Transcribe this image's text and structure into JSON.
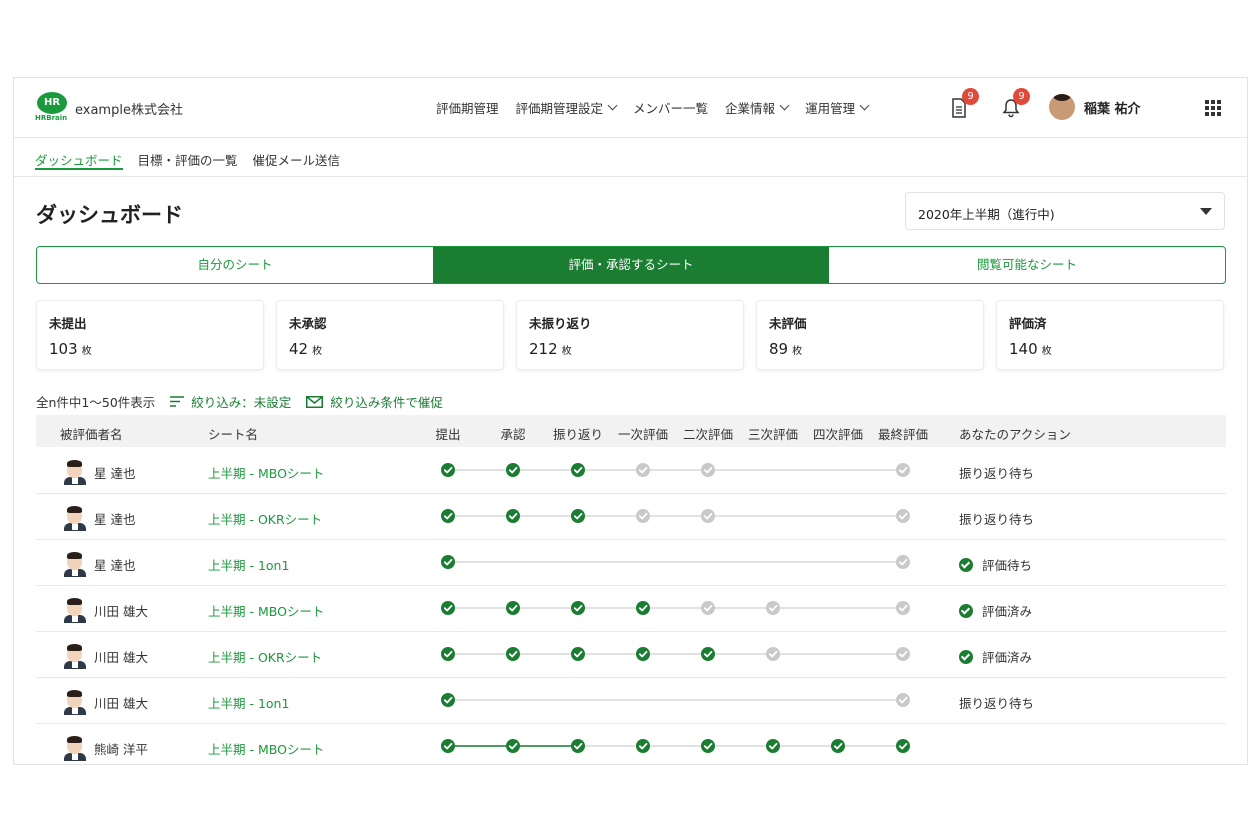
{
  "colors": {
    "accent": "#1a7d32",
    "accent_light": "#1a9a3c",
    "badge": "#e04a3a",
    "inactive": "#c9c9c9"
  },
  "header": {
    "logo_mark": "HR",
    "logo_text": "HRBrain",
    "company": "example株式会社",
    "nav": [
      {
        "label": "評価期管理",
        "dropdown": false
      },
      {
        "label": "評価期管理設定",
        "dropdown": true
      },
      {
        "label": "メンバー一覧",
        "dropdown": false
      },
      {
        "label": "企業情報",
        "dropdown": true
      },
      {
        "label": "運用管理",
        "dropdown": true
      }
    ],
    "doc_badge": "9",
    "bell_badge": "9",
    "user_name": "稲葉 祐介"
  },
  "subnav": [
    "ダッシュボード",
    "目標・評価の一覧",
    "催促メール送信"
  ],
  "page_title": "ダッシュボード",
  "period": "2020年上半期（進行中)",
  "tabs": [
    "自分のシート",
    "評価・承認するシート",
    "閲覧可能なシート"
  ],
  "stats": [
    {
      "label": "未提出",
      "value": "103",
      "unit": "枚"
    },
    {
      "label": "未承認",
      "value": "42",
      "unit": "枚"
    },
    {
      "label": "未振り返り",
      "value": "212",
      "unit": "枚"
    },
    {
      "label": "未評価",
      "value": "89",
      "unit": "枚"
    },
    {
      "label": "評価済",
      "value": "140",
      "unit": "枚"
    }
  ],
  "filter": {
    "count_text": "全n件中1〜50件表示",
    "filter_text": "絞り込み：未設定",
    "remind_text": "絞り込み条件で催促"
  },
  "table": {
    "headers": {
      "name": "被評価者名",
      "sheet": "シート名",
      "steps": [
        "提出",
        "承認",
        "振り返り",
        "一次評価",
        "二次評価",
        "三次評価",
        "四次評価",
        "最終評価"
      ],
      "action": "あなたのアクション"
    },
    "rows": [
      {
        "name": "星 達也",
        "sheet": "上半期 - MBOシート",
        "steps": [
          "done",
          "done",
          "done",
          "pending",
          "pending",
          "none",
          "none",
          "pending"
        ],
        "action": "振り返り待ち",
        "action_check": false
      },
      {
        "name": "星 達也",
        "sheet": "上半期 - OKRシート",
        "steps": [
          "done",
          "done",
          "done",
          "pending",
          "pending",
          "none",
          "none",
          "pending"
        ],
        "action": "振り返り待ち",
        "action_check": false
      },
      {
        "name": "星 達也",
        "sheet": "上半期 - 1on1",
        "steps": [
          "done",
          "none",
          "none",
          "none",
          "none",
          "none",
          "none",
          "pending"
        ],
        "action": "評価待ち",
        "action_check": true
      },
      {
        "name": "川田 雄大",
        "sheet": "上半期 - MBOシート",
        "steps": [
          "done",
          "done",
          "done",
          "done",
          "pending",
          "pending",
          "none",
          "pending"
        ],
        "action": "評価済み",
        "action_check": true
      },
      {
        "name": "川田 雄大",
        "sheet": "上半期 - OKRシート",
        "steps": [
          "done",
          "done",
          "done",
          "done",
          "done",
          "pending",
          "none",
          "pending"
        ],
        "action": "評価済み",
        "action_check": true
      },
      {
        "name": "川田 雄大",
        "sheet": "上半期 - 1on1",
        "steps": [
          "done",
          "none",
          "none",
          "none",
          "none",
          "none",
          "none",
          "pending"
        ],
        "action": "振り返り待ち",
        "action_check": false
      },
      {
        "name": "熊崎 洋平",
        "sheet": "上半期 - MBOシート",
        "steps": [
          "done",
          "done",
          "done",
          "done",
          "done",
          "done",
          "done",
          "done"
        ],
        "action": "",
        "action_check": false
      }
    ]
  }
}
